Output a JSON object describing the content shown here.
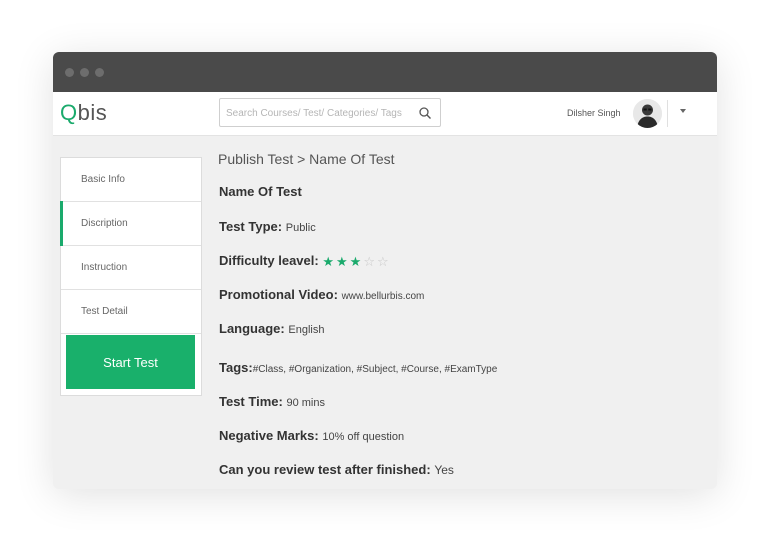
{
  "brand": {
    "logo_q": "Q",
    "logo_rest": "bis"
  },
  "search": {
    "placeholder": "Search Courses/ Test/ Categories/ Tags"
  },
  "user": {
    "name": "Dilsher Singh"
  },
  "sidebar": {
    "items": [
      {
        "label": "Basic Info"
      },
      {
        "label": "Discription"
      },
      {
        "label": "Instruction"
      },
      {
        "label": "Test Detail"
      }
    ],
    "active_index": 1,
    "start_button": "Start Test"
  },
  "main": {
    "breadcrumb": "Publish Test > Name Of Test",
    "title": "Name Of Test",
    "details": {
      "test_type": {
        "label": "Test Type",
        "value": "Public"
      },
      "difficulty": {
        "label": "Difficulty leavel",
        "rating": 3,
        "max": 5
      },
      "video": {
        "label": "Promotional Video",
        "value": "www.bellurbis.com"
      },
      "language": {
        "label": "Language",
        "value": "English"
      },
      "tags": {
        "label": "Tags",
        "value": "#Class, #Organization, #Subject, #Course, #ExamType"
      },
      "time": {
        "label": "Test Time",
        "value": "90 mins"
      },
      "negative": {
        "label": "Negative Marks",
        "value": "10% off question"
      },
      "review": {
        "label": "Can you review test after finished",
        "value": "Yes"
      }
    }
  },
  "colors": {
    "accent": "#1aaa6c",
    "button": "#19b06b",
    "titlebar": "#4a4a4a"
  }
}
